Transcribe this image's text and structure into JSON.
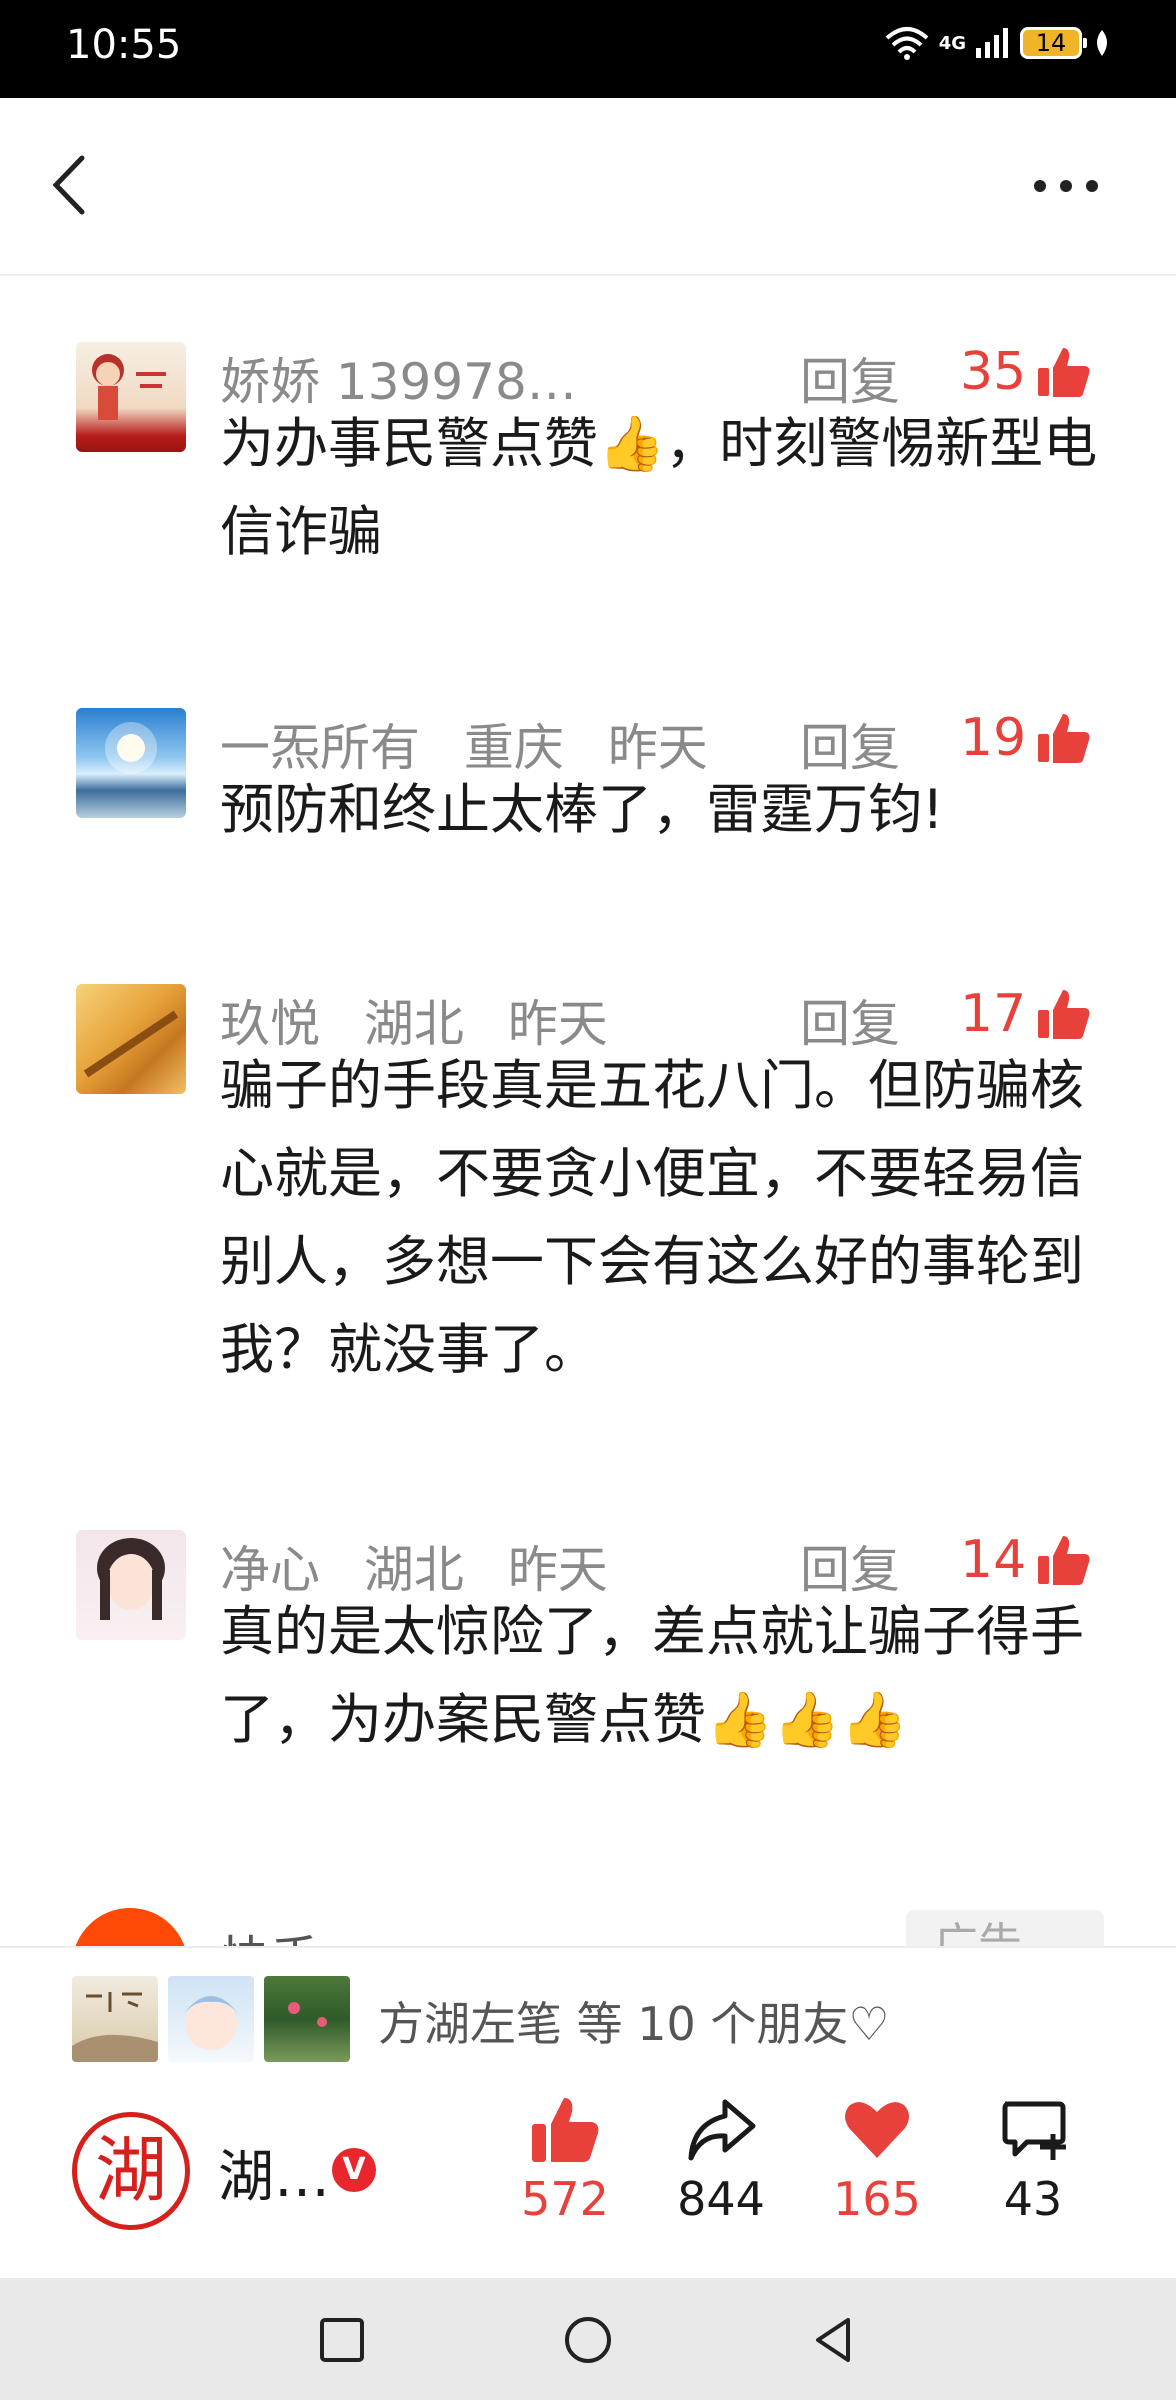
{
  "status_bar": {
    "time": "10:55",
    "network": "4G",
    "battery": "14"
  },
  "header": {
    "back_icon": "chevron-left-icon",
    "more_icon": "more-horizontal-icon"
  },
  "comments": [
    {
      "user": "娇娇 139978…",
      "location": "",
      "time": "",
      "reply": "回复",
      "likes": "35",
      "text": "为办事民警点赞👍，时刻警惕新型电信诈骗"
    },
    {
      "user": "一炁所有",
      "location": "重庆",
      "time": "昨天",
      "reply": "回复",
      "likes": "19",
      "text": "预防和终止太棒了，雷霆万钧!"
    },
    {
      "user": "玖悦",
      "location": "湖北",
      "time": "昨天",
      "reply": "回复",
      "likes": "17",
      "text": "骗子的手段真是五花八门。但防骗核心就是，不要贪小便宜，不要轻易信别人，多想一下会有这么好的事轮到我？就没事了。"
    },
    {
      "user": "净心",
      "location": "湖北",
      "time": "昨天",
      "reply": "回复",
      "likes": "14",
      "text": "真的是太惊险了，差点就让骗子得手了，为办案民警点赞👍👍👍"
    }
  ],
  "ad": {
    "name": "快手",
    "tag": "广告 ⌄"
  },
  "friends": {
    "text": "方湖左笔 等 10 个朋友♡"
  },
  "account": {
    "logo_char": "湖",
    "name": "湖…",
    "badge": "V"
  },
  "actions": {
    "like_count": "572",
    "share_count": "844",
    "favorite_count": "165",
    "comment_count": "43"
  },
  "colors": {
    "accent": "#e8413c",
    "brand": "#d6201c"
  }
}
